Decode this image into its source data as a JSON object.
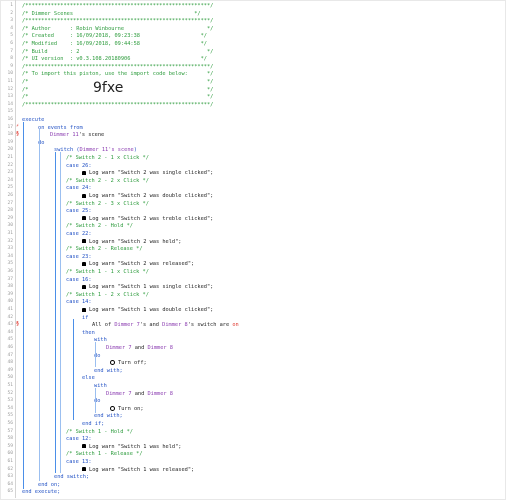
{
  "header": {
    "border": "/**********************************************************/",
    "title": "/* Dimmer Scenes                                      */",
    "rule": "/**********************************************************/",
    "author": "/* Author      : Robin Winbourne                          */",
    "created": "/* Created     : 16/09/2018, 09:23:38                   */",
    "modified": "/* Modified    : 16/09/2018, 09:44:58                   */",
    "build": "/* Build       : 2                                        */",
    "ui_version": "/* UI version  : v0.3.108.20180906                      */",
    "rule2": "/**********************************************************/",
    "import_note": "/* To import this piston, use the import code below:      */",
    "blank1": "/*                                                        */",
    "code": "9fxe",
    "blank2": "/*                                                        */",
    "border_end": "/**********************************************************/"
  },
  "line_numbers": [
    "1",
    "2",
    "3",
    "4",
    "5",
    "6",
    "7",
    "8",
    "9",
    "10",
    "11",
    "12",
    "13",
    "14",
    "15",
    "16",
    "17",
    "18",
    "19",
    "20",
    "21",
    "22",
    "23",
    "24",
    "25",
    "26",
    "27",
    "28",
    "29",
    "30",
    "31",
    "32",
    "33",
    "34",
    "35",
    "36",
    "37",
    "38",
    "39",
    "40",
    "41",
    "42",
    "43",
    "44",
    "45",
    "46",
    "47",
    "48",
    "49",
    "50",
    "51",
    "52",
    "53",
    "54",
    "55",
    "56",
    "57",
    "58",
    "59",
    "60",
    "61",
    "62",
    "63",
    "64",
    "65"
  ],
  "code": {
    "execute": "execute",
    "on_events_from": "on events from",
    "dimmer11_scene_dev": "Dimmer 11",
    "dimmer11_scene_attr": "'s scene",
    "do": "do",
    "switch_open_kw": "switch (",
    "switch_open_arg": "Dimmer 11's scene",
    "switch_open_end": ")",
    "c_sw2_1": "/* Switch 2 - 1 x Click */",
    "case26": "case 26:",
    "log_sw2_single": "Log warn \"Switch 2 was single clicked\";",
    "c_sw2_2": "/* Switch 2 - 2 x Click */",
    "case24": "case 24:",
    "log_sw2_double": "Log warn \"Switch 2 was double clicked\";",
    "c_sw2_3": "/* Switch 2 - 3 x Click */",
    "case25": "case 25:",
    "log_sw2_treble": "Log warn \"Switch 2 was treble clicked\";",
    "c_sw2_hold": "/* Switch 2 - Hold */",
    "case22": "case 22:",
    "log_sw2_held": "Log warn \"Switch 2 was held\";",
    "c_sw2_rel": "/* Switch 2 - Release */",
    "case23": "case 23:",
    "log_sw2_released": "Log warn \"Switch 2 was released\";",
    "c_sw1_1": "/* Switch 1 - 1 x Click */",
    "case16": "case 16:",
    "log_sw1_single": "Log warn \"Switch 1 was single clicked\";",
    "c_sw1_2": "/* Switch 1 - 2 x Click */",
    "case14": "case 14:",
    "log_sw1_double": "Log warn \"Switch 1 was double clicked\";",
    "if": "if",
    "cond_all": "All of ",
    "cond_d7": "Dimmer 7",
    "cond_and": "'s and ",
    "cond_d8": "Dimmer 8",
    "cond_switch": "'s switch are ",
    "cond_on": "on",
    "then": "then",
    "with1": "with",
    "with1_d7": "Dimmer 7",
    "with1_and": " and ",
    "with1_d8": "Dimmer 8",
    "do1": "do",
    "turn_off": "Turn off;",
    "end_with1": "end with;",
    "else": "else",
    "with2": "with",
    "with2_d7": "Dimmer 7",
    "with2_and": " and ",
    "with2_d8": "Dimmer 8",
    "do2": "do",
    "turn_on": "Turn on;",
    "end_with2": "end with;",
    "end_if": "end if;",
    "c_sw1_hold": "/* Switch 1 - Hold */",
    "case12": "case 12:",
    "log_sw1_held": "Log warn \"Switch 1 was held\";",
    "c_sw1_rel": "/* Switch 1 - Release */",
    "case13": "case 13:",
    "log_sw1_released": "Log warn \"Switch 1 was released\";",
    "end_switch": "end switch;",
    "end_on": "end on;",
    "end_execute": "end execute;"
  },
  "markers": {
    "lightning": "⚡",
    "flag": "§"
  },
  "colors": {
    "comment": "#2a9a3a",
    "keyword": "#1f4fc4",
    "device": "#8a3bb0",
    "value": "#e0342b"
  }
}
